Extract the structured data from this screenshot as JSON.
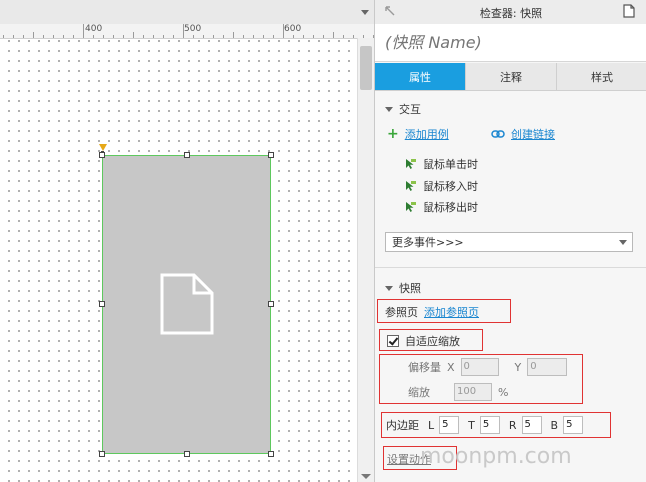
{
  "ruler": {
    "labels": [
      "400",
      "500",
      "600"
    ]
  },
  "inspector": {
    "title": "检查器: 快照",
    "name_placeholder": "(快照 Name)",
    "tabs": [
      {
        "label": "属性",
        "active": true
      },
      {
        "label": "注释",
        "active": false
      },
      {
        "label": "样式",
        "active": false
      }
    ],
    "interaction": {
      "heading": "交互",
      "add_case": "添加用例",
      "create_link": "创建链接",
      "events": [
        "鼠标单击时",
        "鼠标移入时",
        "鼠标移出时"
      ],
      "more_events": "更多事件>>>"
    },
    "snapshot": {
      "heading": "快照",
      "ref_page_label": "参照页",
      "add_ref_page": "添加参照页",
      "auto_fit_label": "自适应缩放",
      "auto_fit_checked": true,
      "offset_label": "偏移量",
      "x_label": "X",
      "x_value": "0",
      "y_label": "Y",
      "y_value": "0",
      "scale_label": "缩放",
      "scale_value": "100",
      "scale_unit": "%",
      "padding_label": "内边距",
      "pad_l_label": "L",
      "pad_l": "5",
      "pad_t_label": "T",
      "pad_t": "5",
      "pad_r_label": "R",
      "pad_r": "5",
      "pad_b_label": "B",
      "pad_b": "5",
      "set_action": "设置动作"
    }
  },
  "watermark": "moonpm.com",
  "colors": {
    "accent": "#1a9ee0",
    "highlight": "#e03333",
    "selection": "#5ec85e",
    "link": "#1a86d0"
  }
}
